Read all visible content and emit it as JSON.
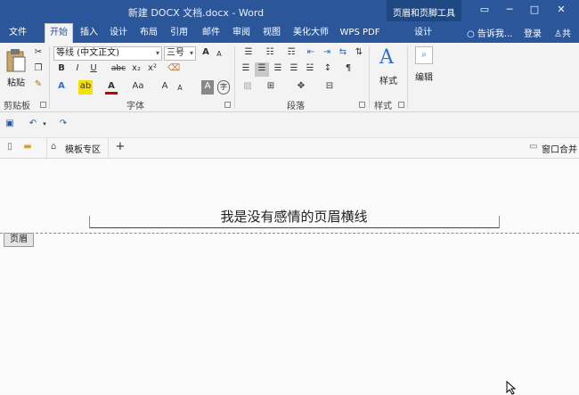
{
  "window": {
    "title": "新建 DOCX 文档.docx - Word",
    "contextual_group": "页眉和页脚工具",
    "controls": [
      "▭",
      "─",
      "□",
      "✕"
    ]
  },
  "tabs": [
    "文件",
    "开始",
    "插入",
    "设计",
    "布局",
    "引用",
    "邮件",
    "审阅",
    "视图",
    "美化大师",
    "WPS PDF",
    "设计"
  ],
  "tell_me": "告诉我...",
  "login": "登录",
  "share": "共",
  "clipboard": {
    "paste": "粘贴",
    "label": "剪贴板"
  },
  "font": {
    "name": "等线 (中文正文)",
    "size": "三号",
    "label": "字体",
    "buttons": {
      "grow": "A",
      "shrink": "A",
      "bold": "B",
      "italic": "I",
      "underline": "U",
      "strike": "abc",
      "sub": "x₂",
      "sup": "x²",
      "effects": "A",
      "highlight": "ab",
      "color": "A",
      "case": "Aa",
      "grow2": "A",
      "shrink2": "A",
      "shade": "A",
      "enclose": "字"
    }
  },
  "paragraph": {
    "label": "段落"
  },
  "styles": {
    "button": "样式",
    "label": "样式"
  },
  "editing": {
    "button": "编辑"
  },
  "wps_tabs": {
    "templates": "模板专区",
    "add": "+",
    "window_merge": "窗口合并"
  },
  "document": {
    "header_text": "我是没有感情的页眉横线",
    "header_tag": "页眉"
  },
  "colors": {
    "ribbon_blue": "#2b579a",
    "highlight": "#f5e000",
    "font_color": "#c00000"
  }
}
